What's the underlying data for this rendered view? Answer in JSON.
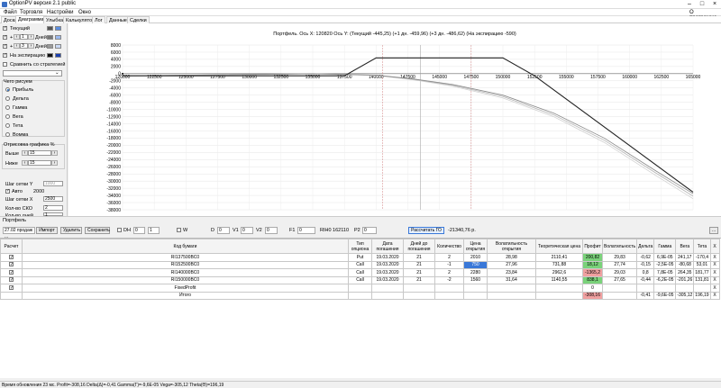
{
  "app": {
    "title": "OptionPV версия 2.1 public",
    "about": "О программе"
  },
  "menu": [
    "Файл",
    "Торговля",
    "Настройки",
    "Окно"
  ],
  "tabs": [
    "Доска",
    "Диаграмма",
    "Улыбка",
    "Калькулятор",
    "Лог",
    "Данные",
    "Сделки"
  ],
  "left": {
    "current_label": "Текущий",
    "plus1_label": "+",
    "plus1_value": "1",
    "plus1_unit": "Дней",
    "plus3_label": "+",
    "plus3_value": "3",
    "plus3_unit": "Дней",
    "expiry_label": "На экспирацию",
    "compare_label": "Сравнить со стратегией",
    "draw_group_label": "Чего рисуем",
    "radios": [
      "Прибыль",
      "Дельта",
      "Гамма",
      "Вега",
      "Тета",
      "Вомма"
    ],
    "render_group_label": "Отрисовка графика %",
    "top_label": "Выше",
    "top_value": "15",
    "bottom_label": "Ниже",
    "bottom_value": "15",
    "grid_y_label": "Шаг сетки Y",
    "grid_y_value": "1000",
    "auto_label": "Авто",
    "auto_value": "2000",
    "grid_x_label": "Шаг сетки X",
    "grid_x_value": "2500",
    "sko_label": "Кол-во СКО",
    "sko_value": "2",
    "extra_label": "Кол-во дней",
    "extra_value": "1",
    "colors": {
      "current": "#555555",
      "current2": "#5b8ee0",
      "plus1": "#777777",
      "plus1b": "#9ab8ee",
      "plus3": "#999999",
      "plus3b": "#cbd9f4",
      "expiry": "#111111",
      "expiry2": "#1a3fb0"
    }
  },
  "chart": {
    "title": "Портфель. Ось X: 120820 Ось Y: (Текущий -445,25) (+1 дн. -459,96) (+3 дн. -486,62) (На экспирацию -590)"
  },
  "chart_data": {
    "type": "line",
    "xlim": [
      120000,
      165000
    ],
    "ylim": [
      -38000,
      8000
    ],
    "xticks": [
      120000,
      122500,
      125000,
      127500,
      130000,
      132500,
      135000,
      137500,
      140000,
      142500,
      145000,
      147500,
      150000,
      152500,
      155000,
      157500,
      160000,
      162500,
      165000
    ],
    "yticks": [
      8000,
      6000,
      4000,
      2000,
      0,
      -2000,
      -4000,
      -6000,
      -8000,
      -10000,
      -12000,
      -14000,
      -16000,
      -18000,
      -20000,
      -22000,
      -24000,
      -26000,
      -28000,
      -30000,
      -32000,
      -34000,
      -36000,
      -38000
    ],
    "series": [
      {
        "color": "#222222",
        "x": [
          120000,
          137500,
          140000,
          150000,
          152500,
          165000
        ],
        "y": [
          -590,
          -590,
          4410,
          4410,
          -590,
          -33090
        ]
      },
      {
        "color": "#8a8a8a",
        "x": [
          120000,
          128000,
          135000,
          140000,
          143000,
          146000,
          150000,
          154000,
          158000,
          162000,
          165000
        ],
        "y": [
          -600,
          -300,
          0,
          -400,
          -1500,
          -3000,
          -6000,
          -11000,
          -18000,
          -27000,
          -33500
        ]
      },
      {
        "color": "#b5b5b5",
        "x": [
          120000,
          128000,
          135000,
          140000,
          143000,
          146000,
          150000,
          154000,
          158000,
          162000,
          165000
        ],
        "y": [
          -620,
          -320,
          -40,
          -450,
          -1600,
          -3200,
          -6400,
          -11500,
          -18600,
          -27600,
          -34200
        ]
      },
      {
        "color": "#d2d2d2",
        "x": [
          120000,
          128000,
          135000,
          140000,
          143000,
          146000,
          150000,
          154000,
          158000,
          162000,
          165000
        ],
        "y": [
          -650,
          -360,
          -90,
          -520,
          -1750,
          -3450,
          -6800,
          -12000,
          -19200,
          -28300,
          -34900
        ]
      }
    ],
    "vlines": [
      {
        "x": 140500,
        "color": "#d08080"
      },
      {
        "x": 143500,
        "color": "#999999"
      },
      {
        "x": 147500,
        "color": "#d08080"
      }
    ]
  },
  "toolbar": {
    "portfolio_label": "Портфель",
    "portfolio_value": "27.02 продаж ...",
    "import_label": "Импорт",
    "delete_label": "Удалить",
    "save_label": "Сохранить",
    "dh_label": "DH",
    "dh_v1": "0",
    "dh_v2": "1",
    "w_label": "W",
    "d_label": "D",
    "d_value": "0",
    "v1_label": "V1",
    "v1_value": "0",
    "v2_label": "V2",
    "v2_value": "0",
    "f1_label": "F1",
    "f1_value": "0",
    "ri_label": "RIH0 162110",
    "p2_label": "P2",
    "p2_value": "0",
    "calc_label": "Рассчитать ГО",
    "calc_value": "-21340,76 р.",
    "more_label": "..."
  },
  "table": {
    "headers": [
      "Расчет",
      "Код бумаги",
      "Тип опциона",
      "Дата погашения",
      "Дней до погашения",
      "Количество",
      "Цена открытия",
      "Волатильность открытия",
      "Теоретическая цена",
      "Профит",
      "Волатильность",
      "Дельта",
      "Гамма",
      "Вега",
      "Тета",
      "X"
    ],
    "rows": [
      {
        "code": "RI137500BC0",
        "type": "Put",
        "date": "19.03.2020",
        "days": "21",
        "qty": "2",
        "price": "2010",
        "volopen": "28,98",
        "theo": "2110,41",
        "profit": "200,82",
        "vol": "29,83",
        "delta": "-0,62",
        "gamma": "6,9E-05",
        "vega": "241,17",
        "theta": "-170,4",
        "x": "X",
        "pcls": "g",
        "prc": ""
      },
      {
        "code": "RI152500BC0",
        "type": "Call",
        "date": "19.03.2020",
        "days": "21",
        "qty": "-1",
        "price": "750",
        "volopen": "27,96",
        "theo": "731,88",
        "profit": "18,12",
        "vol": "27,74",
        "delta": "-0,15",
        "gamma": "-2,5E-05",
        "vega": "-80,68",
        "theta": "53,01",
        "x": "X",
        "pcls": "g",
        "prc": "b"
      },
      {
        "code": "RI140000BC0",
        "type": "Call",
        "date": "19.03.2020",
        "days": "21",
        "qty": "2",
        "price": "2280",
        "volopen": "23,84",
        "theo": "2962,6",
        "profit": "-1365,2",
        "vol": "29,03",
        "delta": "0,8",
        "gamma": "7,8E-05",
        "vega": "264,35",
        "theta": "181,77",
        "x": "X",
        "pcls": "r",
        "prc": ""
      },
      {
        "code": "RI150000BC0",
        "type": "Call",
        "date": "19.03.2020",
        "days": "21",
        "qty": "-2",
        "price": "1560",
        "volopen": "31,64",
        "theo": "1140,55",
        "profit": "838,1",
        "vol": "27,65",
        "delta": "-0,44",
        "gamma": "-6,2E-05",
        "vega": "-201,26",
        "theta": "131,81",
        "x": "X",
        "pcls": "g",
        "prc": ""
      }
    ],
    "fixed": {
      "code": "FixedProfit",
      "profit": "0",
      "x": "X"
    },
    "total": {
      "code": "Итого",
      "profit": "-308,16",
      "delta": "-0,41",
      "gamma": "-9,6E-05",
      "vega": "-305,12",
      "theta": "196,19",
      "x": "X"
    }
  },
  "status": "Время обновления 23 мс. Profit=-308,16 Delta(Δ)=-0,41 Gamma(Γ)=-9,6E-05 Vega=-305,12 Theta(Θ)=196,19"
}
